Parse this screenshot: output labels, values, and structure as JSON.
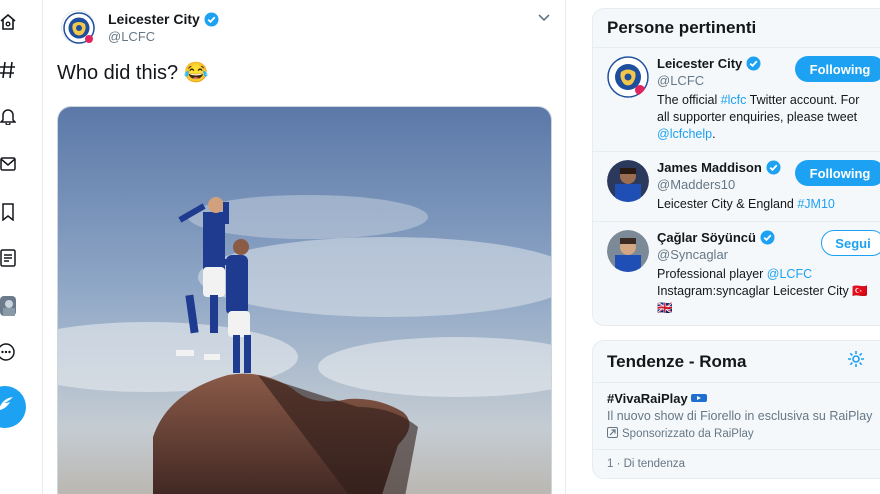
{
  "rail": {
    "icons": [
      "home-icon",
      "explore-icon",
      "notifications-icon",
      "messages-icon",
      "bookmarks-icon",
      "lists-icon",
      "profile-icon",
      "more-icon"
    ],
    "compose_icon": "feather-icon"
  },
  "tweet": {
    "author_name": "Leicester City",
    "author_handle": "@LCFC",
    "text": "Who did this? 😂",
    "media_alt": "photo"
  },
  "relevant_people": {
    "title": "Persone pertinenti",
    "people": [
      {
        "name": "Leicester City",
        "handle": "@LCFC",
        "bio_parts": [
          "The official ",
          "#lcfc",
          " Twitter account. For all supporter enquiries, please tweet ",
          "@lcfchelp",
          "."
        ],
        "button": "Following"
      },
      {
        "name": "James Maddison",
        "handle": "@Madders10",
        "bio_parts": [
          "Leicester City & England ",
          "#JM10"
        ],
        "button": "Following"
      },
      {
        "name": "Çağlar Söyüncü",
        "handle": "@Syncaglar",
        "bio_parts": [
          "Professional player ",
          "@LCFC",
          "\nInstagram:syncaglar Leicester City 🇹🇷 🇬🇧"
        ],
        "button": "Segui"
      }
    ]
  },
  "trends": {
    "title": "Tendenze - Roma",
    "items": [
      {
        "tag": "#VivaRaiPlay",
        "description": "Il nuovo show di Fiorello in esclusiva su RaiPlay",
        "promoted": "Sponsorizzato da RaiPlay"
      }
    ],
    "next_meta": "1 · Di tendenza"
  },
  "colors": {
    "accent": "#1da1f2",
    "text": "#14171a",
    "muted": "#657786"
  }
}
